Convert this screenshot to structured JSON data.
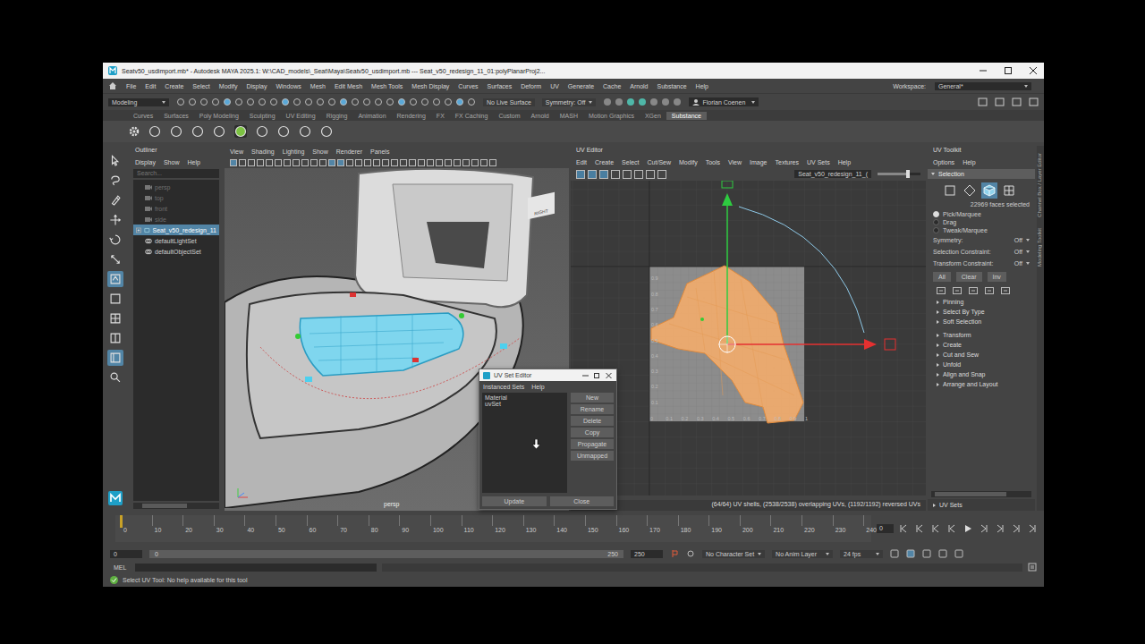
{
  "window": {
    "title": "Seatv50_usdimport.mb* - Autodesk MAYA 2025.1: W:\\CAD_models\\_Seat\\Maya\\Seatv50_usdimport.mb  ---  Seat_v50_redesign_11_01:polyPlanarProj2..."
  },
  "menu_bar": {
    "items": [
      "File",
      "Edit",
      "Create",
      "Select",
      "Modify",
      "Display",
      "Windows",
      "Mesh",
      "Edit Mesh",
      "Mesh Tools",
      "Mesh Display",
      "Curves",
      "Surfaces",
      "Deform",
      "UV",
      "Generate",
      "Cache",
      "Arnold",
      "Substance",
      "Help"
    ],
    "workspace_label": "Workspace:",
    "workspace": "General*"
  },
  "status_line": {
    "mode": "Modeling",
    "live_surface": "No Live Surface",
    "symmetry": "Symmetry: Off",
    "user": "Florian Coenen"
  },
  "shelf": {
    "tabs": [
      {
        "label": "Curves",
        "selected": false
      },
      {
        "label": "Surfaces",
        "selected": false
      },
      {
        "label": "Poly Modeling",
        "selected": false
      },
      {
        "label": "Sculpting",
        "selected": false
      },
      {
        "label": "UV Editing",
        "selected": false
      },
      {
        "label": "Rigging",
        "selected": false
      },
      {
        "label": "Animation",
        "selected": false
      },
      {
        "label": "Rendering",
        "selected": false
      },
      {
        "label": "FX",
        "selected": false
      },
      {
        "label": "FX Caching",
        "selected": false
      },
      {
        "label": "Custom",
        "selected": false
      },
      {
        "label": "Arnold",
        "selected": false
      },
      {
        "label": "MASH",
        "selected": false
      },
      {
        "label": "Motion Graphics",
        "selected": false
      },
      {
        "label": "XGen",
        "selected": false
      },
      {
        "label": "Substance",
        "selected": true
      }
    ]
  },
  "toolbox": [
    {
      "kind": "select",
      "selected": false
    },
    {
      "kind": "lasso",
      "selected": false
    },
    {
      "kind": "paint",
      "selected": false
    },
    {
      "kind": "move",
      "selected": false
    },
    {
      "kind": "rotate",
      "selected": false
    },
    {
      "kind": "scale",
      "selected": false
    },
    {
      "kind": "uv-select",
      "selected": true
    },
    {
      "kind": "single-pane",
      "selected": false
    },
    {
      "kind": "four-pane",
      "selected": false
    },
    {
      "kind": "two-pane",
      "selected": false
    },
    {
      "kind": "outliner-pane",
      "selected": true
    },
    {
      "kind": "zoom",
      "selected": false
    }
  ],
  "outliner": {
    "title": "Outliner",
    "menu": [
      "Display",
      "Show",
      "Help"
    ],
    "search_placeholder": "Search...",
    "items": [
      {
        "label": "persp",
        "kind": "camera",
        "hidden": true,
        "selected": false
      },
      {
        "label": "top",
        "kind": "camera",
        "hidden": true,
        "selected": false
      },
      {
        "label": "front",
        "kind": "camera",
        "hidden": true,
        "selected": false
      },
      {
        "label": "side",
        "kind": "camera",
        "hidden": true,
        "selected": false
      },
      {
        "label": "Seat_v50_redesign_11",
        "kind": "group",
        "hidden": false,
        "selected": true
      },
      {
        "label": "defaultLightSet",
        "kind": "set",
        "hidden": false,
        "selected": false
      },
      {
        "label": "defaultObjectSet",
        "kind": "set",
        "hidden": false,
        "selected": false
      }
    ]
  },
  "viewport": {
    "menu": [
      "View",
      "Shading",
      "Lighting",
      "Show",
      "Renderer",
      "Panels"
    ],
    "camera": "persp",
    "view_cube": "RIGHT"
  },
  "uv_editor": {
    "title": "UV Editor",
    "menu": [
      "Edit",
      "Create",
      "Select",
      "Cut/Sew",
      "Modify",
      "Tools",
      "View",
      "Image",
      "Textures",
      "UV Sets",
      "Help"
    ],
    "object": "Seat_v50_redesign_11_(",
    "slider": {
      "level": 0.7
    },
    "v_ticks": [
      "0.9",
      "0.8",
      "0.7",
      "0.6",
      "0.5",
      "0.4",
      "0.3",
      "0.2",
      "0.1"
    ],
    "u_ticks": [
      "0",
      "0.1",
      "0.2",
      "0.3",
      "0.4",
      "0.5",
      "0.6",
      "0.7",
      "0.8",
      "0.9",
      "1"
    ],
    "status": "(64/64) UV shells, (2538/2538) overlapping UVs, (1192/1192) reversed UVs"
  },
  "uv_set_editor": {
    "title": "UV Set Editor",
    "menu": [
      "Instanced Sets",
      "Help"
    ],
    "sets": [
      {
        "label": "Material",
        "selected": false
      },
      {
        "label": "uvSet",
        "selected": false
      }
    ],
    "buttons": [
      "New",
      "Rename",
      "Delete",
      "Copy",
      "Propagate",
      "Unmapped"
    ],
    "footer_buttons": [
      "Update",
      "Close"
    ]
  },
  "uv_toolkit": {
    "title": "UV Toolkit",
    "menu": [
      "Options",
      "Help"
    ],
    "section": "Selection",
    "component_modes": [
      {
        "kind": "square",
        "selected": false
      },
      {
        "kind": "diamond",
        "selected": false
      },
      {
        "kind": "cube",
        "selected": true
      },
      {
        "kind": "uv",
        "selected": false
      }
    ],
    "count": "22969 faces selected",
    "modes": [
      {
        "label": "Pick/Marquee",
        "selected": true
      },
      {
        "label": "Drag",
        "selected": false
      },
      {
        "label": "Tweak/Marquee",
        "selected": false
      }
    ],
    "options": [
      {
        "label": "Symmetry:",
        "value": "Off"
      },
      {
        "label": "Selection Constraint:",
        "value": "Off"
      },
      {
        "label": "Transform Constraint:",
        "value": "Off"
      }
    ],
    "buttons": [
      "All",
      "Clear",
      "Inv"
    ],
    "sub_sections": [
      "Pinning",
      "Select By Type",
      "Soft Selection"
    ],
    "sections": [
      "Transform",
      "Create",
      "Cut and Sew",
      "Unfold",
      "Align and Snap",
      "Arrange and Layout"
    ],
    "footer": "UV Sets"
  },
  "side_tabs": [
    "Channel Box / Layer Editor",
    "Modeling Toolkit"
  ],
  "timeline": {
    "ticks": [
      "0",
      "10",
      "20",
      "30",
      "40",
      "50",
      "60",
      "70",
      "80",
      "90",
      "100",
      "110",
      "120",
      "130",
      "140",
      "150",
      "160",
      "170",
      "180",
      "190",
      "200",
      "210",
      "220",
      "230",
      "240"
    ],
    "current": "0"
  },
  "range": {
    "start": "0",
    "range_start": "0",
    "range_end": "250",
    "end": "250",
    "character_set": "No Character Set",
    "anim_layer": "No Anim Layer",
    "fps": "24 fps"
  },
  "command_line": {
    "language": "MEL"
  },
  "help_line": "Select UV Tool: No help available for this tool"
}
